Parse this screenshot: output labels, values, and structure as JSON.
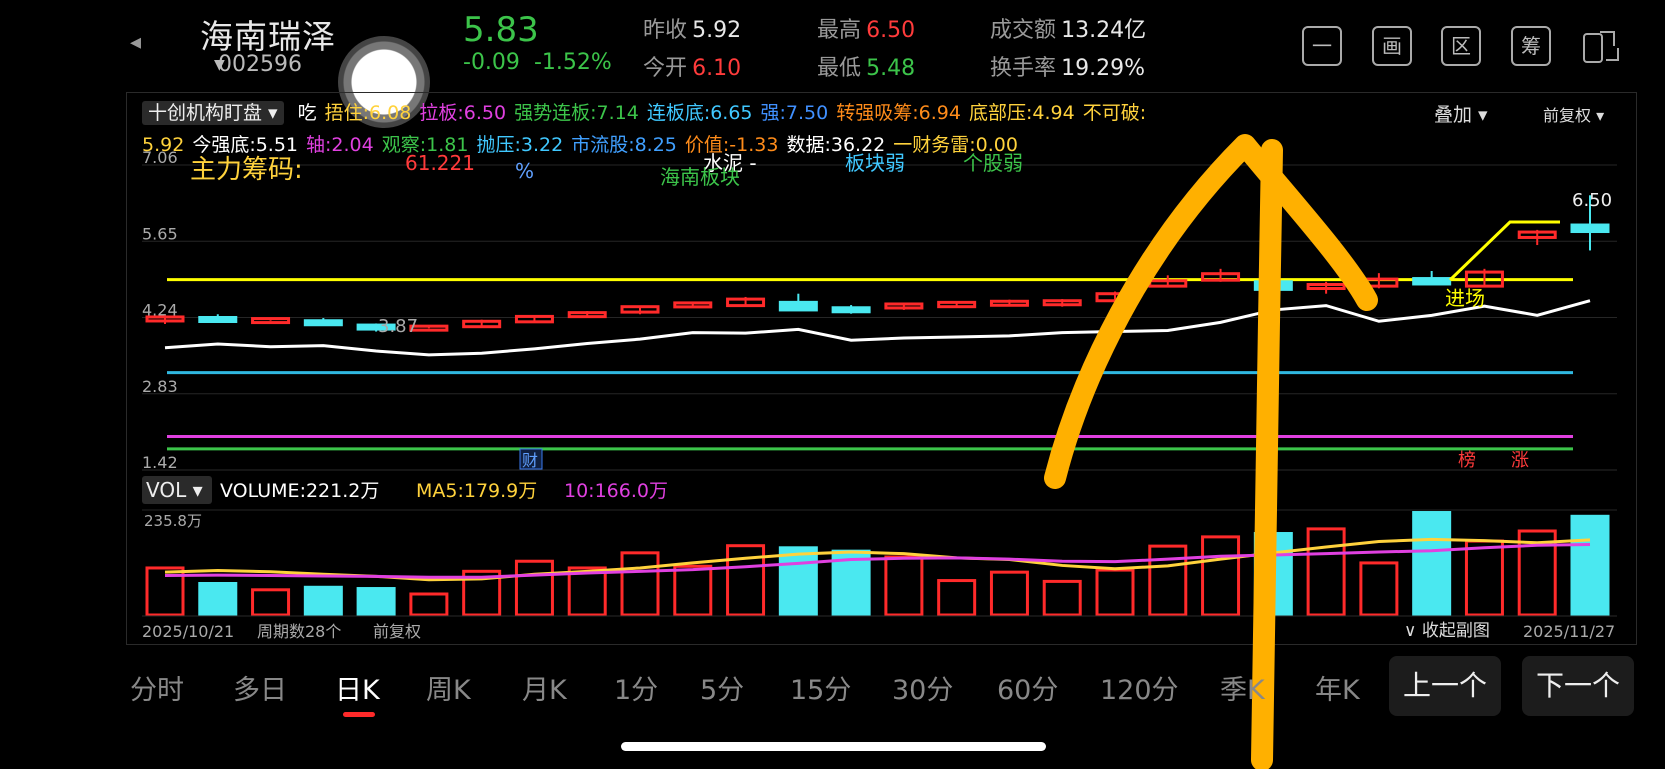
{
  "header": {
    "back_icon": "chevron-left-icon",
    "stock_name": "海南瑞泽",
    "stock_code": "002596",
    "price": "5.83",
    "change": "-0.09",
    "change_pct": "-1.52%",
    "stats": [
      {
        "label": "昨收",
        "value": "5.92"
      },
      {
        "label": "今开",
        "value": "6.10"
      },
      {
        "label": "最高",
        "value": "6.50"
      },
      {
        "label": "最低",
        "value": "5.48"
      },
      {
        "label": "成交额",
        "value": "13.24亿"
      },
      {
        "label": "换手率",
        "value": "19.29%"
      }
    ],
    "toolbar": [
      "一",
      "画",
      "区",
      "筹"
    ]
  },
  "indicator": {
    "selector": "十创机构盯盘",
    "overlay_label": "叠加",
    "adjust_label": "前复权",
    "row1": [
      {
        "t": "吃",
        "c": "#ffffff"
      },
      {
        "t": "捂住:6.08",
        "c": "#ffd23c"
      },
      {
        "t": "拉板:6.50",
        "c": "#e040e0"
      },
      {
        "t": "强势连板:7.14",
        "c": "#3cc44a"
      },
      {
        "t": "连板底:6.65",
        "c": "#40c8ff"
      },
      {
        "t": "强:7.50",
        "c": "#4090ff"
      },
      {
        "t": "转强吸筹:6.94",
        "c": "#ff8c1a"
      },
      {
        "t": "底部压:4.94",
        "c": "#ffd23c"
      },
      {
        "t": "不可破:",
        "c": "#ffd23c"
      }
    ],
    "row2": [
      {
        "t": "5.92",
        "c": "#ffd23c"
      },
      {
        "t": "今强底:5.51",
        "c": "#ffffff"
      },
      {
        "t": "轴:2.04",
        "c": "#e040e0"
      },
      {
        "t": "观察:1.81",
        "c": "#3cc44a"
      },
      {
        "t": "抛压:3.22",
        "c": "#40c8ff"
      },
      {
        "t": "市流股:8.25",
        "c": "#40a0ff"
      },
      {
        "t": "价值:-1.33",
        "c": "#ff8c1a"
      },
      {
        "t": "数据:36.22",
        "c": "#ffffff"
      },
      {
        "t": "一财务雷:0.00",
        "c": "#ffd23c"
      }
    ],
    "row3": [
      {
        "t": "主力筹码:",
        "c": "#ffd23c"
      },
      {
        "t": "61.221",
        "c": "#ff3b3b"
      },
      {
        "t": "%",
        "c": "#60a0ff"
      },
      {
        "t": "水泥 -",
        "c": "#ffffff"
      },
      {
        "t": "海南板块",
        "c": "#3cc44a"
      },
      {
        "t": "板块弱",
        "c": "#40c8ff"
      },
      {
        "t": "个股弱",
        "c": "#3cc44a"
      }
    ]
  },
  "chart_data": {
    "type": "candlestick",
    "price_axis": [
      "7.06",
      "5.65",
      "4.24",
      "2.83",
      "1.42"
    ],
    "low_label": "3.87",
    "high_label": "6.50",
    "entry_label": "进场",
    "markers": {
      "fin": "财",
      "bang": "榜",
      "zhang": "涨"
    },
    "candles": [
      {
        "o": 4.25,
        "c": 4.18,
        "h": 4.28,
        "l": 4.12,
        "up": false
      },
      {
        "o": 4.2,
        "c": 4.24,
        "h": 4.3,
        "l": 4.17,
        "up": true
      },
      {
        "o": 4.22,
        "c": 4.2,
        "h": 4.24,
        "l": 4.18,
        "up": false
      },
      {
        "o": 4.18,
        "c": 4.13,
        "h": 4.23,
        "l": 4.1,
        "up": true
      },
      {
        "o": 4.1,
        "c": 4.06,
        "h": 4.13,
        "l": 3.98,
        "up": true
      },
      {
        "o": 4.06,
        "c": 4.08,
        "h": 4.1,
        "l": 4.04,
        "up": false
      },
      {
        "o": 4.07,
        "c": 4.17,
        "h": 4.2,
        "l": 4.05,
        "up": false
      },
      {
        "o": 4.16,
        "c": 4.26,
        "h": 4.28,
        "l": 4.15,
        "up": false
      },
      {
        "o": 4.29,
        "c": 4.33,
        "h": 4.36,
        "l": 4.27,
        "up": false
      },
      {
        "o": 4.34,
        "c": 4.44,
        "h": 4.46,
        "l": 4.3,
        "up": false
      },
      {
        "o": 4.45,
        "c": 4.51,
        "h": 4.52,
        "l": 4.43,
        "up": false
      },
      {
        "o": 4.46,
        "c": 4.58,
        "h": 4.62,
        "l": 4.44,
        "up": false
      },
      {
        "o": 4.52,
        "c": 4.38,
        "h": 4.68,
        "l": 4.36,
        "up": true
      },
      {
        "o": 4.42,
        "c": 4.4,
        "h": 4.47,
        "l": 4.31,
        "up": true
      },
      {
        "o": 4.42,
        "c": 4.49,
        "h": 4.5,
        "l": 4.38,
        "up": false
      },
      {
        "o": 4.44,
        "c": 4.52,
        "h": 4.54,
        "l": 4.42,
        "up": false
      },
      {
        "o": 4.49,
        "c": 4.54,
        "h": 4.57,
        "l": 4.46,
        "up": false
      },
      {
        "o": 4.48,
        "c": 4.55,
        "h": 4.58,
        "l": 4.44,
        "up": false
      },
      {
        "o": 4.55,
        "c": 4.68,
        "h": 4.72,
        "l": 4.5,
        "up": false
      },
      {
        "o": 4.82,
        "c": 4.92,
        "h": 5.02,
        "l": 4.8,
        "up": false
      },
      {
        "o": 4.93,
        "c": 5.05,
        "h": 5.14,
        "l": 4.9,
        "up": false
      },
      {
        "o": 4.9,
        "c": 4.76,
        "h": 5.02,
        "l": 4.72,
        "up": true
      },
      {
        "o": 4.78,
        "c": 4.85,
        "h": 4.9,
        "l": 4.68,
        "up": false
      },
      {
        "o": 4.82,
        "c": 4.95,
        "h": 5.06,
        "l": 4.78,
        "up": false
      },
      {
        "o": 4.96,
        "c": 4.86,
        "h": 5.1,
        "l": 4.84,
        "up": true
      },
      {
        "o": 4.82,
        "c": 5.08,
        "h": 5.14,
        "l": 4.8,
        "up": false
      },
      {
        "o": 5.72,
        "c": 5.82,
        "h": 5.86,
        "l": 5.58,
        "up": false
      },
      {
        "o": 5.95,
        "c": 5.83,
        "h": 6.5,
        "l": 5.48,
        "up": true
      }
    ],
    "ma_line": [
      3.68,
      3.75,
      3.7,
      3.72,
      3.62,
      3.55,
      3.58,
      3.66,
      3.76,
      3.84,
      3.96,
      3.95,
      4.02,
      3.82,
      3.86,
      3.88,
      3.9,
      3.96,
      3.98,
      4.0,
      4.15,
      4.38,
      4.46,
      4.17,
      4.28,
      4.45,
      4.28,
      4.55
    ],
    "h_lines": [
      {
        "v": 4.94,
        "c": "#ffff00"
      },
      {
        "v": 3.22,
        "c": "#30b8e0"
      },
      {
        "v": 2.04,
        "c": "#e040e0"
      },
      {
        "v": 1.81,
        "c": "#3cc44a"
      }
    ],
    "volume": {
      "selector": "VOL",
      "legend": [
        {
          "t": "VOLUME:221.2万",
          "c": "#ffffff"
        },
        {
          "t": "MA5:179.9万",
          "c": "#ffd23c"
        },
        {
          "t": "10:166.0万",
          "c": "#e040e0"
        }
      ],
      "max_label": "235.8万",
      "values": [
        112,
        75,
        60,
        66,
        63,
        50,
        104,
        128,
        112,
        148,
        116,
        165,
        160,
        152,
        138,
        82,
        102,
        80,
        107,
        164,
        186,
        194,
        205,
        124,
        244,
        176,
        200,
        235
      ],
      "ma5": [
        102,
        106,
        103,
        97,
        92,
        84,
        86,
        97,
        104,
        112,
        124,
        135,
        145,
        150,
        146,
        136,
        132,
        118,
        110,
        117,
        133,
        148,
        162,
        175,
        180,
        177,
        172,
        179
      ],
      "ma10": [
        94,
        95,
        94,
        93,
        92,
        90,
        90,
        95,
        100,
        104,
        108,
        115,
        123,
        132,
        135,
        136,
        133,
        128,
        127,
        133,
        140,
        143,
        146,
        150,
        153,
        160,
        166,
        168
      ]
    },
    "date_start": "2025/10/21",
    "period_count": "周期数28个",
    "period_adjust": "前复权",
    "collapse_label": "收起副图",
    "date_end": "2025/11/27"
  },
  "period_tabs": [
    "分时",
    "多日",
    "日K",
    "周K",
    "月K",
    "1分",
    "5分",
    "15分",
    "30分",
    "60分",
    "120分",
    "季K",
    "年K"
  ],
  "active_tab": "日K",
  "nav": {
    "prev": "上一个",
    "next": "下一个"
  }
}
